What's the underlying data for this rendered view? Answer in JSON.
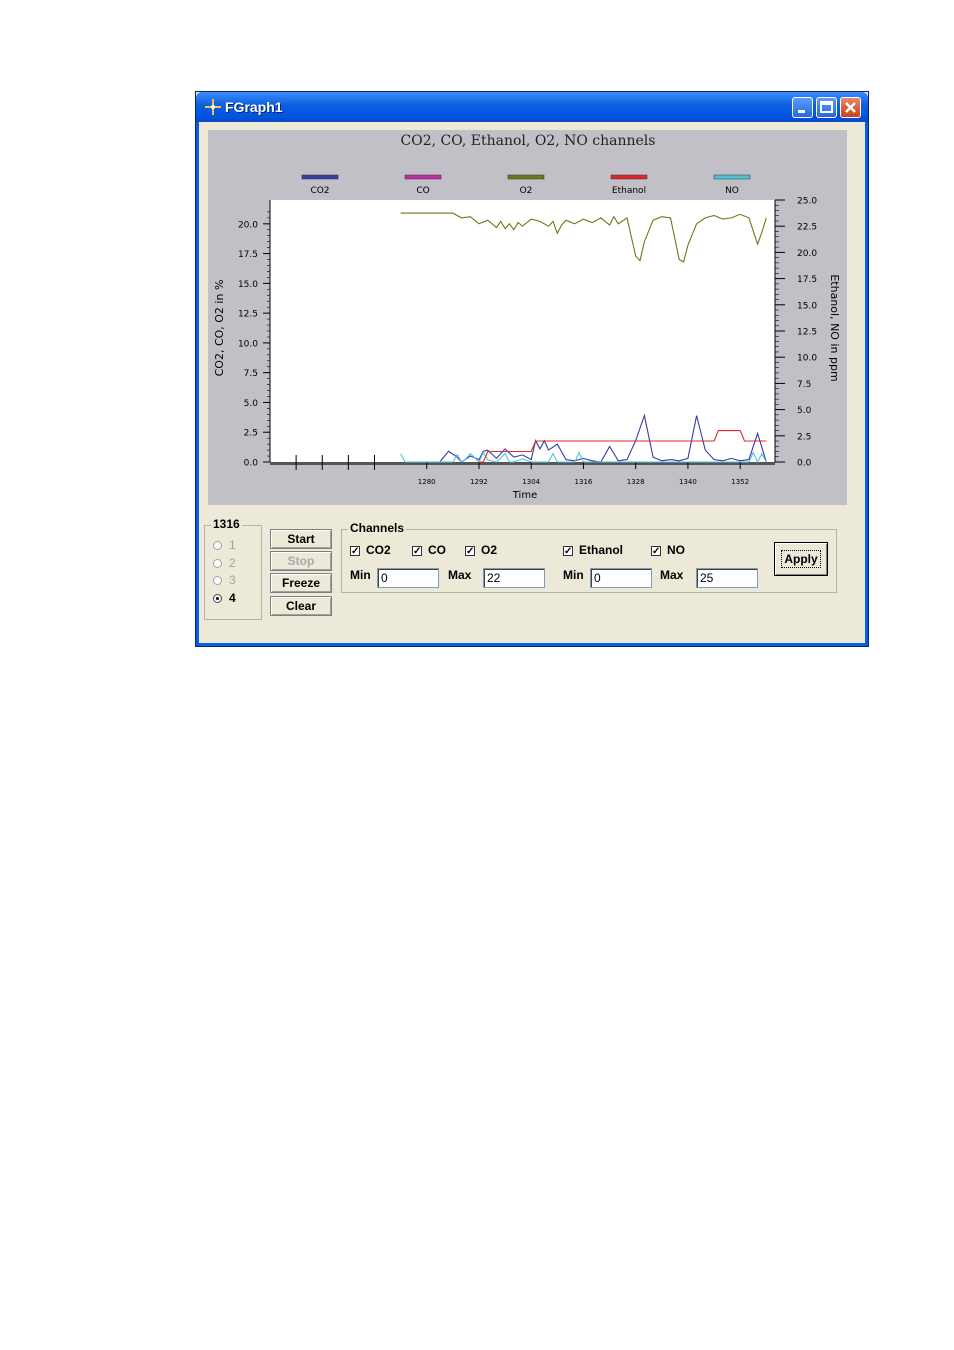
{
  "window": {
    "title": "FGraph1"
  },
  "colors": {
    "co2": "#3a3aa8",
    "co": "#c42aa8",
    "o2": "#6b7a1a",
    "ethanol": "#e0282a",
    "no": "#4fc3d6",
    "chart_bg": "#c0c0c6"
  },
  "chart_data": {
    "type": "line",
    "title": "CO2, CO, Ethanol, O2, NO channels",
    "xlabel": "Time",
    "ylabel": "CO2, CO, O2 in %",
    "y2label": "Ethanol, NO in ppm",
    "x_ticks": [
      "1280",
      "1292",
      "1304",
      "1316",
      "1328",
      "1340",
      "1352"
    ],
    "ylim": [
      0,
      22
    ],
    "y_ticks": [
      "0.0",
      "2.5",
      "5.0",
      "7.5",
      "10.0",
      "12.5",
      "15.0",
      "17.5",
      "20.0"
    ],
    "y2lim": [
      0,
      25
    ],
    "y2_ticks": [
      "0.0",
      "2.5",
      "5.0",
      "7.5",
      "10.0",
      "12.5",
      "15.0",
      "17.5",
      "20.0",
      "22.5",
      "25.0"
    ],
    "legend": [
      "CO2",
      "CO",
      "O2",
      "Ethanol",
      "NO"
    ],
    "legend_position": "top",
    "xlim": [
      1244,
      1360
    ],
    "series": [
      {
        "name": "O2",
        "axis": "left",
        "x": [
          1274,
          1286,
          1288,
          1290,
          1292,
          1294,
          1296,
          1297,
          1298,
          1299,
          1300,
          1301,
          1302,
          1304,
          1306,
          1308,
          1309,
          1310,
          1311,
          1312,
          1314,
          1316,
          1318,
          1320,
          1322,
          1323,
          1324,
          1326,
          1328,
          1329,
          1330,
          1332,
          1334,
          1336,
          1338,
          1339,
          1340,
          1342,
          1344,
          1346,
          1348,
          1350,
          1352,
          1354,
          1356,
          1357,
          1358
        ],
        "values": [
          20.9,
          20.9,
          20.5,
          20.6,
          20.0,
          20.3,
          19.7,
          20.2,
          19.6,
          20.0,
          19.5,
          20.1,
          19.8,
          20.4,
          20.2,
          19.8,
          20.2,
          19.2,
          19.9,
          20.3,
          20.0,
          20.4,
          20.1,
          20.5,
          19.9,
          20.6,
          20.0,
          20.5,
          17.3,
          16.9,
          18.5,
          20.3,
          20.6,
          20.5,
          17.0,
          16.8,
          18.2,
          20.0,
          20.5,
          20.7,
          20.4,
          20.5,
          20.8,
          20.5,
          18.3,
          19.3,
          20.5
        ]
      },
      {
        "name": "CO2",
        "axis": "left",
        "x": [
          1283,
          1285,
          1287,
          1288,
          1290,
          1292,
          1293,
          1294,
          1296,
          1298,
          1300,
          1302,
          1304,
          1305,
          1306,
          1307,
          1308,
          1310,
          1312,
          1314,
          1316,
          1318,
          1320,
          1322,
          1324,
          1326,
          1328,
          1330,
          1332,
          1334,
          1336,
          1338,
          1340,
          1342,
          1344,
          1346,
          1348,
          1350,
          1352,
          1354,
          1356,
          1358
        ],
        "values": [
          0.0,
          0.9,
          0.4,
          0.0,
          0.5,
          0.2,
          0.9,
          1.0,
          0.3,
          1.1,
          0.4,
          0.6,
          0.2,
          1.8,
          1.1,
          1.8,
          1.0,
          1.5,
          0.2,
          0.1,
          0.3,
          0.1,
          0.0,
          1.3,
          0.1,
          0.2,
          1.8,
          3.9,
          0.4,
          0.1,
          0.2,
          0.1,
          0.3,
          3.9,
          1.0,
          0.2,
          0.1,
          0.3,
          0.1,
          0.2,
          2.4,
          0.0
        ]
      },
      {
        "name": "NO",
        "axis": "right",
        "x": [
          1274,
          1275,
          1276,
          1286,
          1287,
          1288,
          1289,
          1290,
          1292,
          1293,
          1294,
          1296,
          1298,
          1299,
          1300,
          1302,
          1304,
          1306,
          1308,
          1309,
          1310,
          1312,
          1314,
          1315,
          1316,
          1320,
          1326,
          1334,
          1336,
          1346,
          1348,
          1352,
          1354,
          1355,
          1356,
          1357,
          1358
        ],
        "values": [
          0.8,
          0.0,
          0.0,
          0.0,
          0.7,
          0.0,
          0.3,
          0.8,
          0.0,
          0.9,
          0.2,
          0.0,
          0.8,
          0.0,
          0.0,
          0.3,
          0.0,
          0.0,
          0.0,
          0.8,
          0.0,
          0.0,
          0.0,
          0.9,
          0.0,
          0.0,
          0.0,
          0.0,
          0.0,
          0.0,
          0.0,
          0.0,
          0.0,
          0.9,
          0.0,
          0.8,
          0.0
        ]
      },
      {
        "name": "Ethanol",
        "axis": "right",
        "x": [
          1292,
          1293,
          1294,
          1303,
          1304,
          1305,
          1309,
          1310,
          1320,
          1321,
          1330,
          1331,
          1336,
          1337,
          1346,
          1347,
          1352,
          1353,
          1358
        ],
        "values": [
          0,
          0,
          1,
          1,
          1,
          2,
          2,
          2,
          2,
          2,
          2,
          2,
          2,
          2,
          2,
          3,
          3,
          2,
          2
        ]
      }
    ]
  },
  "controls": {
    "group_title": "1316",
    "radio_options": [
      "1",
      "2",
      "3",
      "4"
    ],
    "selected_radio": "4",
    "buttons": {
      "start": "Start",
      "stop": "Stop",
      "freeze": "Freeze",
      "clear": "Clear"
    },
    "channels_title": "Channels",
    "checks": {
      "co2": "CO2",
      "co": "CO",
      "o2": "O2",
      "ethanol": "Ethanol",
      "no": "NO"
    },
    "left_min_label": "Min",
    "left_max_label": "Max",
    "left_min": "0",
    "left_max": "22",
    "right_min_label": "Min",
    "right_max_label": "Max",
    "right_min": "0",
    "right_max": "25",
    "apply": "Apply"
  }
}
